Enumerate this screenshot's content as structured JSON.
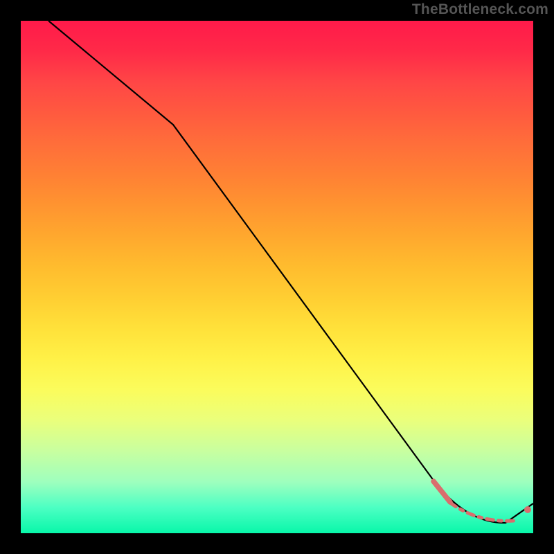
{
  "watermark": "TheBottleneck.com",
  "chart_data": {
    "type": "line",
    "title": "",
    "xlabel": "",
    "ylabel": "",
    "xlim": [
      0,
      100
    ],
    "ylim": [
      0,
      100
    ],
    "series": [
      {
        "name": "bottleneck-curve",
        "x": [
          5,
          30,
          81,
          85,
          95,
          100
        ],
        "y": [
          100,
          80,
          10,
          4,
          2,
          6
        ],
        "color": "#000000"
      },
      {
        "name": "optimal-range",
        "x": [
          81,
          95
        ],
        "y": [
          4.5,
          2.5
        ],
        "color": "#d96d6d",
        "style": "dashed"
      }
    ],
    "points": [
      {
        "name": "optimal-end-dot",
        "x": 98.5,
        "y": 4.8,
        "color": "#d96d6d"
      }
    ],
    "grid": false,
    "legend": false
  }
}
